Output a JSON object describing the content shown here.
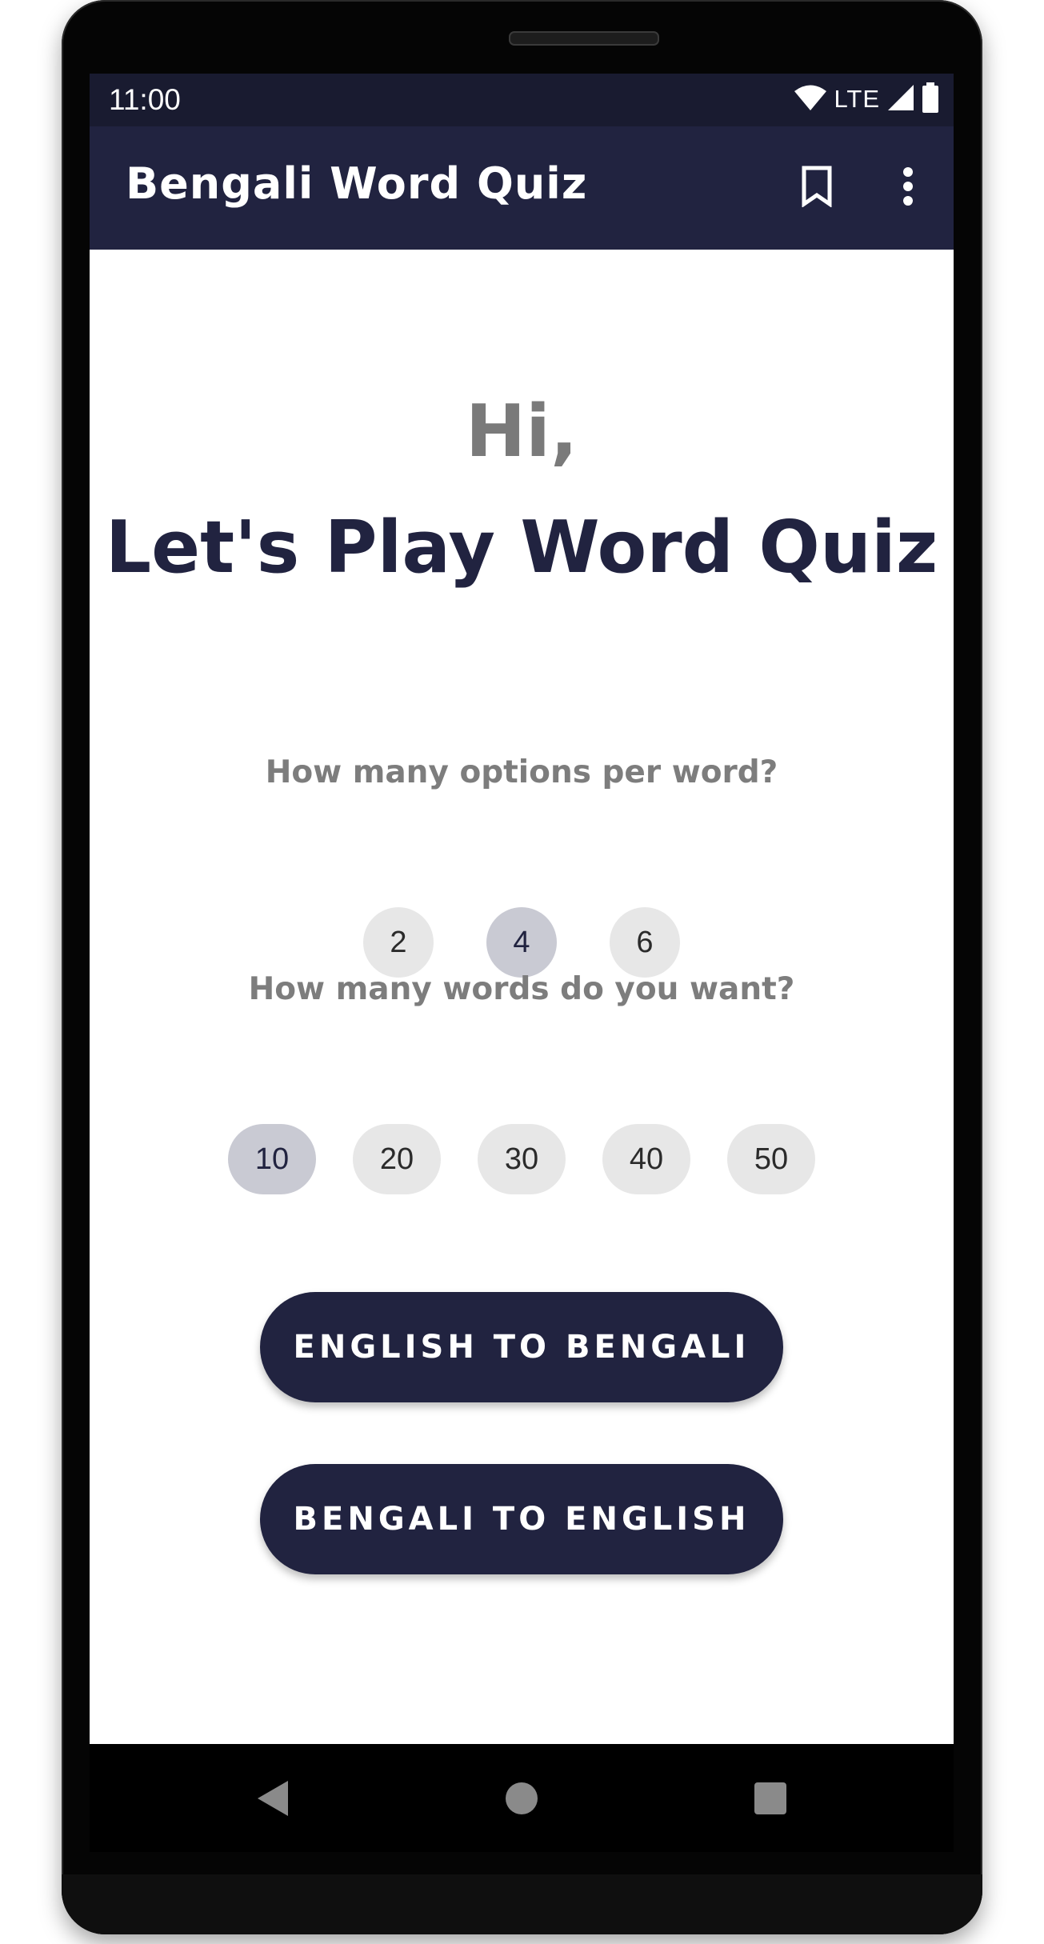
{
  "status_bar": {
    "time": "11:00",
    "network": "LTE",
    "icons": [
      "wifi-icon",
      "signal-icon",
      "battery-icon"
    ]
  },
  "app_bar": {
    "title": "Bengali Word Quiz",
    "actions": [
      "bookmark-icon",
      "overflow-menu-icon"
    ]
  },
  "main": {
    "greeting": "Hi,",
    "headline": "Let's Play Word Quiz",
    "options_question": "How many options per word?",
    "options_choices": [
      "2",
      "4",
      "6"
    ],
    "options_selected": "4",
    "words_question": "How many words do you want?",
    "words_choices": [
      "10",
      "20",
      "30",
      "40",
      "50"
    ],
    "words_selected": "10",
    "buttons": {
      "english_to_bengali": "ENGLISH TO BENGALI",
      "bengali_to_english": "BENGALI TO ENGLISH"
    }
  },
  "nav_bar": {
    "icons": [
      "back-icon",
      "home-icon",
      "recents-icon"
    ]
  },
  "colors": {
    "primary": "#212340",
    "status_bar": "#191b30",
    "chip": "#e7e7e7",
    "chip_selected": "#c9cad3",
    "greeting": "#7a7a7a"
  }
}
